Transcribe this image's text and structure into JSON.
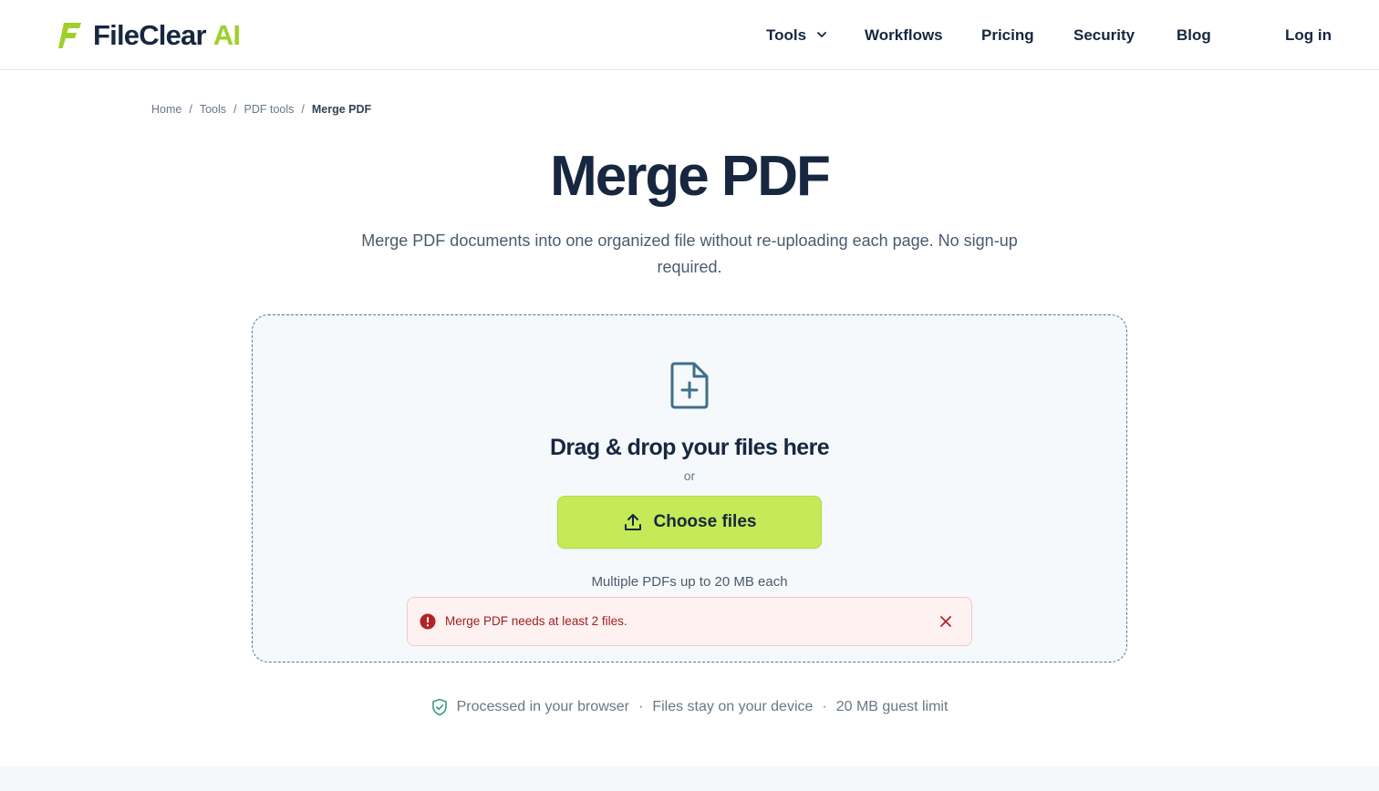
{
  "brand": {
    "name": "FileClear",
    "suffix": "AI",
    "colors": {
      "primary": "#16273f",
      "accent": "#9fd02a",
      "button": "#c4ea58",
      "error": "#b42323"
    }
  },
  "nav": {
    "tools": "Tools",
    "workflows": "Workflows",
    "pricing": "Pricing",
    "security": "Security",
    "blog": "Blog",
    "login": "Log in"
  },
  "breadcrumb": {
    "items": [
      "Home",
      "Tools",
      "PDF tools"
    ],
    "separator": "/",
    "current": "Merge PDF"
  },
  "page": {
    "title": "Merge PDF",
    "subtitle": "Merge PDF documents into one organized file without re-uploading each page. No sign-up required."
  },
  "dropzone": {
    "icon": "file-plus-icon",
    "title": "Drag & drop your files here",
    "or": "or",
    "button_label": "Choose files",
    "button_icon": "upload-icon",
    "limit": "Multiple PDFs up to 20 MB each"
  },
  "alert": {
    "icon": "alert-circle-icon",
    "message": "Merge PDF needs at least 2 files.",
    "close_icon": "close-icon"
  },
  "trust": {
    "icon": "shield-check-icon",
    "items": [
      "Processed in your browser",
      "Files stay on your device",
      "20 MB guest limit"
    ],
    "separator": "·"
  }
}
